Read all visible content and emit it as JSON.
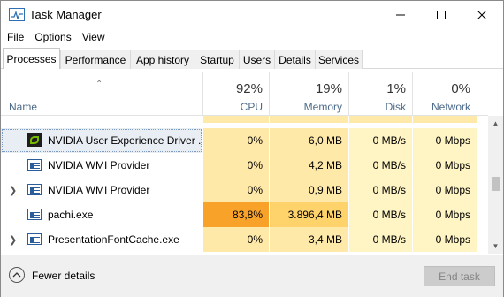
{
  "window": {
    "title": "Task Manager"
  },
  "menu": [
    "File",
    "Options",
    "View"
  ],
  "tabs": [
    {
      "label": "Processes",
      "active": true
    },
    {
      "label": "Performance",
      "active": false
    },
    {
      "label": "App history",
      "active": false
    },
    {
      "label": "Startup",
      "active": false
    },
    {
      "label": "Users",
      "active": false
    },
    {
      "label": "Details",
      "active": false
    },
    {
      "label": "Services",
      "active": false
    }
  ],
  "columns": {
    "name": "Name",
    "cpu": {
      "pct": "92%",
      "label": "CPU"
    },
    "memory": {
      "pct": "19%",
      "label": "Memory"
    },
    "disk": {
      "pct": "1%",
      "label": "Disk"
    },
    "network": {
      "pct": "0%",
      "label": "Network"
    }
  },
  "rows": [
    {
      "name": "NVIDIA User Experience Driver ...",
      "icon": "nvidia-icon",
      "expandable": false,
      "cpu": "0%",
      "memory": "6,0 MB",
      "disk": "0 MB/s",
      "network": "0 Mbps",
      "selected": true
    },
    {
      "name": "NVIDIA WMI Provider",
      "icon": "process-icon",
      "expandable": false,
      "cpu": "0%",
      "memory": "4,2 MB",
      "disk": "0 MB/s",
      "network": "0 Mbps",
      "selected": false
    },
    {
      "name": "NVIDIA WMI Provider",
      "icon": "process-icon",
      "expandable": true,
      "cpu": "0%",
      "memory": "0,9 MB",
      "disk": "0 MB/s",
      "network": "0 Mbps",
      "selected": false
    },
    {
      "name": "pachi.exe",
      "icon": "process-icon",
      "expandable": false,
      "cpu": "83,8%",
      "memory": "3.896,4 MB",
      "disk": "0 MB/s",
      "network": "0 Mbps",
      "selected": false
    },
    {
      "name": "PresentationFontCache.exe",
      "icon": "process-icon",
      "expandable": true,
      "cpu": "0%",
      "memory": "3,4 MB",
      "disk": "0 MB/s",
      "network": "0 Mbps",
      "selected": false
    }
  ],
  "colors": {
    "heat_light": "#fff4c4",
    "heat_mid": "#ffe9a8",
    "heat_hot": "#f8a22a",
    "heat_memory_hot": "#ffd36b"
  },
  "footer": {
    "fewer_details": "Fewer details",
    "end_task": "End task"
  }
}
